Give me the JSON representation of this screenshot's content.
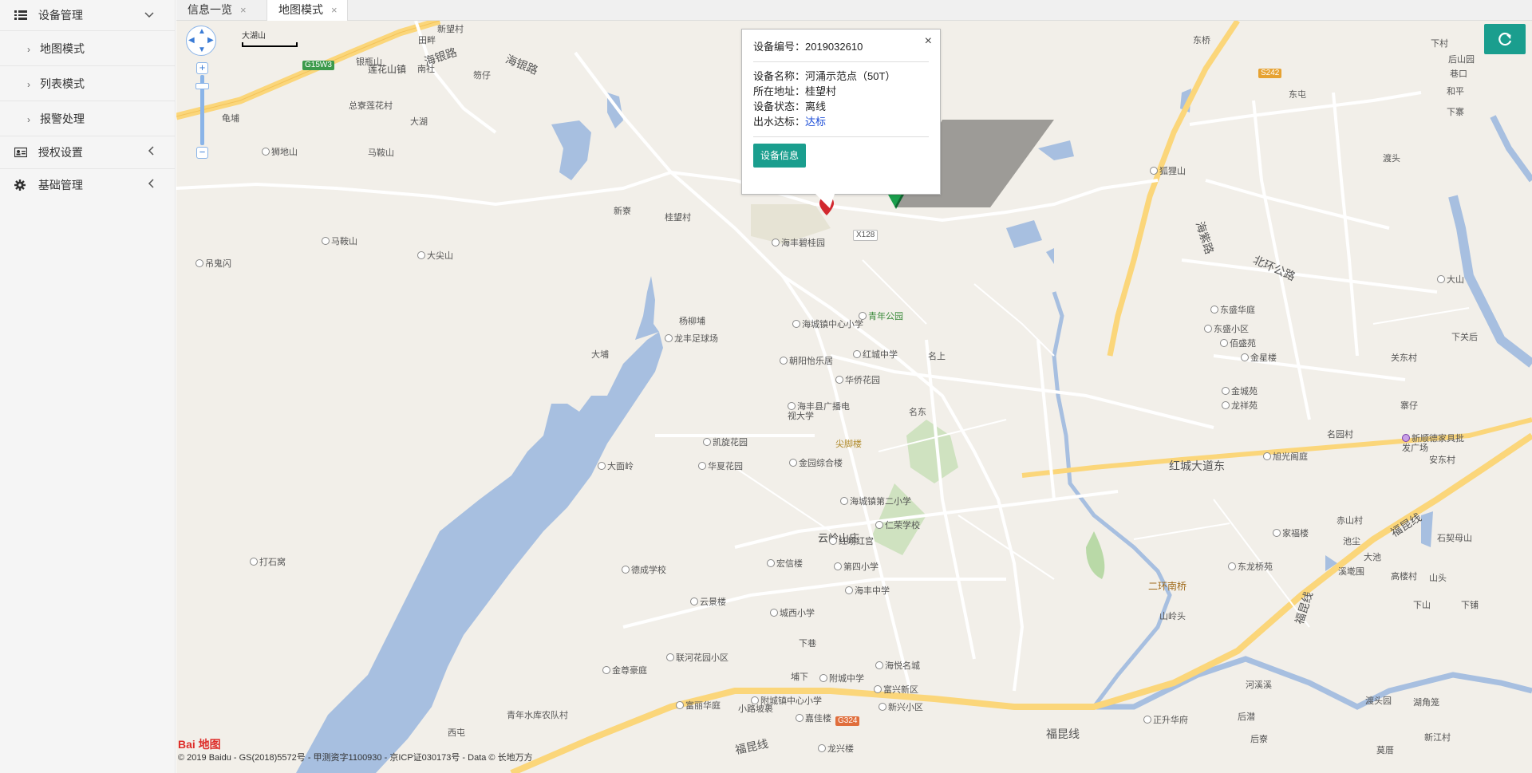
{
  "sidebar": {
    "groups": [
      {
        "label": "设备管理",
        "icon": "list-icon",
        "expanded": true,
        "items": [
          {
            "label": "地图模式"
          },
          {
            "label": "列表模式"
          },
          {
            "label": "报警处理"
          }
        ]
      },
      {
        "label": "授权设置",
        "icon": "id-card-icon",
        "expanded": false
      },
      {
        "label": "基础管理",
        "icon": "gear-icon",
        "expanded": false
      }
    ]
  },
  "tabs": [
    {
      "label": "信息一览",
      "close": "×",
      "active": false
    },
    {
      "label": "地图模式",
      "close": "×",
      "active": true
    }
  ],
  "map": {
    "scale_label": "大湖山",
    "zoom_in": "+",
    "zoom_out": "−",
    "infowindow": {
      "close": "×",
      "id_label": "设备编号：",
      "id_value": "2019032610",
      "name_label": "设备名称：",
      "name_value": "河涌示范点（50T）",
      "addr_label": "所在地址：",
      "addr_value": "桂望村",
      "status_label": "设备状态：",
      "status_value": "离线",
      "water_label": "出水达标：",
      "water_value": "达标",
      "button": "设备信息"
    },
    "towns": [
      {
        "text": "莲花山镇"
      },
      {
        "text": "海银路"
      },
      {
        "text": "海银路"
      },
      {
        "text": "南社"
      },
      {
        "text": "新望村"
      },
      {
        "text": "田畔"
      },
      {
        "text": "银瓶山"
      },
      {
        "text": "笏仔"
      },
      {
        "text": "总寮"
      },
      {
        "text": "莲花村"
      },
      {
        "text": "大湖"
      },
      {
        "text": "马鞍山"
      },
      {
        "text": "龟埔"
      },
      {
        "text": "狮地山"
      },
      {
        "text": "马鞍山"
      },
      {
        "text": "大尖山"
      },
      {
        "text": "吊鬼闪"
      },
      {
        "text": "新寮"
      },
      {
        "text": "桂望村"
      },
      {
        "text": "海丰碧桂园"
      },
      {
        "text": "杨柳埔"
      },
      {
        "text": "龙丰足球场"
      },
      {
        "text": "大埔"
      },
      {
        "text": "海城镇中心小学"
      },
      {
        "text": "青年公园"
      },
      {
        "text": "红城中学"
      },
      {
        "text": "名上"
      },
      {
        "text": "朝阳怡乐居"
      },
      {
        "text": "华侨花园"
      },
      {
        "text": "海丰县广播电视大学"
      },
      {
        "text": "名东"
      },
      {
        "text": "尖脚楼"
      },
      {
        "text": "凯旋花园"
      },
      {
        "text": "大面岭"
      },
      {
        "text": "华夏花园"
      },
      {
        "text": "金园综合楼"
      },
      {
        "text": "红城大道东"
      },
      {
        "text": "海城镇第二小学"
      },
      {
        "text": "仁荣学校"
      },
      {
        "text": "云岭山庄"
      },
      {
        "text": "红场红宫"
      },
      {
        "text": "德成学校"
      },
      {
        "text": "宏信楼"
      },
      {
        "text": "第四小学"
      },
      {
        "text": "打石窝"
      },
      {
        "text": "海丰中学"
      },
      {
        "text": "二环南桥"
      },
      {
        "text": "云景楼"
      },
      {
        "text": "城西小学"
      },
      {
        "text": "山岭头"
      },
      {
        "text": "下巷"
      },
      {
        "text": "联河花园小区"
      },
      {
        "text": "金尊豪庭"
      },
      {
        "text": "埔下"
      },
      {
        "text": "附城中学"
      },
      {
        "text": "海悦名城"
      },
      {
        "text": "富丽华庭"
      },
      {
        "text": "附城镇中心小学"
      },
      {
        "text": "富兴新区"
      },
      {
        "text": "小路坡裹"
      },
      {
        "text": "嘉佳楼"
      },
      {
        "text": "新兴小区"
      },
      {
        "text": "青年水库农队村"
      },
      {
        "text": "西屯"
      },
      {
        "text": "福昆线"
      },
      {
        "text": "福昆线"
      },
      {
        "text": "龙兴楼"
      },
      {
        "text": "正升华府"
      },
      {
        "text": "后潜"
      },
      {
        "text": "后寮"
      },
      {
        "text": "东桥"
      },
      {
        "text": "东屯"
      },
      {
        "text": "狐狸山"
      },
      {
        "text": "海紫路"
      },
      {
        "text": "北环公路"
      },
      {
        "text": "东盛华庭"
      },
      {
        "text": "东盛小区"
      },
      {
        "text": "佰盛苑"
      },
      {
        "text": "金星楼"
      },
      {
        "text": "金城苑"
      },
      {
        "text": "龙祥苑"
      },
      {
        "text": "旭光阁庭"
      },
      {
        "text": "名园村"
      },
      {
        "text": "家福楼"
      },
      {
        "text": "东龙桥苑"
      },
      {
        "text": "赤山村"
      },
      {
        "text": "池尘"
      },
      {
        "text": "大池"
      },
      {
        "text": "溪墘围"
      },
      {
        "text": "福昆线"
      },
      {
        "text": "福昆线"
      },
      {
        "text": "高楼村"
      },
      {
        "text": "山头"
      },
      {
        "text": "下山"
      },
      {
        "text": "下铺"
      },
      {
        "text": "石契母山"
      },
      {
        "text": "新顺德家具批发广场"
      },
      {
        "text": "安东村"
      },
      {
        "text": "寨仔"
      },
      {
        "text": "关东村"
      },
      {
        "text": "下关后"
      },
      {
        "text": "大山"
      },
      {
        "text": "下寨"
      },
      {
        "text": "和平"
      },
      {
        "text": "巷口"
      },
      {
        "text": "后山园"
      },
      {
        "text": "下村"
      },
      {
        "text": "渡头"
      },
      {
        "text": "河溪溪"
      },
      {
        "text": "渡头园"
      },
      {
        "text": "湖角笼"
      },
      {
        "text": "新江村"
      },
      {
        "text": "莫厝"
      }
    ],
    "shields": [
      {
        "text": "G15W3"
      },
      {
        "text": "S242"
      },
      {
        "text": "G324"
      },
      {
        "text": "X128"
      }
    ],
    "logo": "Bai 地图",
    "copyright": "© 2019 Baidu - GS(2018)5572号 - 甲测资字1100930 - 京ICP证030173号 - Data © 长地万方"
  }
}
